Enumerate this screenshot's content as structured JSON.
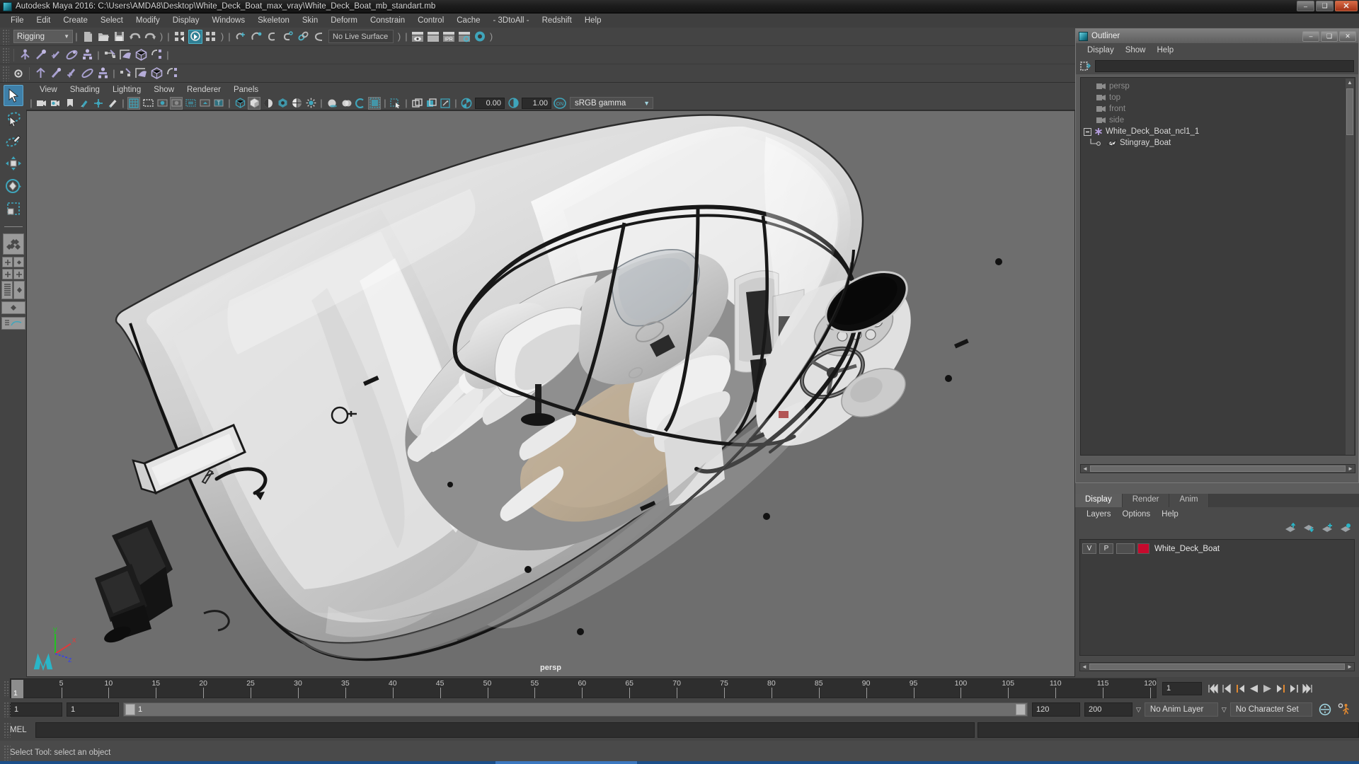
{
  "window": {
    "title": "Autodesk Maya 2016: C:\\Users\\AMDA8\\Desktop\\White_Deck_Boat_max_vray\\White_Deck_Boat_mb_standart.mb",
    "app_icon": "maya-icon",
    "minimize": "–",
    "maximize": "❑",
    "close": "✕"
  },
  "menubar": {
    "items": [
      {
        "label": "File"
      },
      {
        "label": "Edit"
      },
      {
        "label": "Create"
      },
      {
        "label": "Select"
      },
      {
        "label": "Modify"
      },
      {
        "label": "Display"
      },
      {
        "label": "Windows"
      },
      {
        "label": "Skeleton"
      },
      {
        "label": "Skin"
      },
      {
        "label": "Deform"
      },
      {
        "label": "Constrain"
      },
      {
        "label": "Control"
      },
      {
        "label": "Cache"
      },
      {
        "label": "- 3DtoAll -"
      },
      {
        "label": "Redshift"
      },
      {
        "label": "Help"
      }
    ]
  },
  "status_toolbar": {
    "menu_set": "Rigging",
    "menu_set_arrow": "▼",
    "live_surface": "No Live Surface",
    "icons": [
      "new-scene-icon",
      "open-scene-icon",
      "save-scene-icon",
      "undo-icon",
      "redo-icon",
      "select-by-hierarchy-icon",
      "select-by-object-icon",
      "select-by-component-icon",
      "snap-to-grid-icon",
      "snap-to-curve-icon",
      "snap-to-point-icon",
      "snap-to-projected-center-icon",
      "snap-to-view-plane-icon",
      "make-live-icon",
      "render-current-frame-icon",
      "ipr-render-icon",
      "render-settings-icon",
      "hypershade-icon"
    ]
  },
  "shelf": {
    "icons": [
      "joint-tool-icon",
      "ik-handle-tool-icon",
      "ik-spline-handle-icon",
      "paint-weights-icon",
      "skin-bind-icon",
      "cluster-icon",
      "lattice-icon",
      "wrap-icon",
      "sculpt-deformer-icon",
      "parent-constraint-icon",
      "point-constraint-icon",
      "orient-constraint-icon",
      "aim-constraint-icon",
      "pole-vector-icon",
      "mirror-joint-icon",
      "set-driven-key-icon",
      "character-set-icon"
    ]
  },
  "viewport": {
    "menu": [
      {
        "label": "View"
      },
      {
        "label": "Shading"
      },
      {
        "label": "Lighting"
      },
      {
        "label": "Show"
      },
      {
        "label": "Renderer"
      },
      {
        "label": "Panels"
      }
    ],
    "exposure": "0.00",
    "gamma": "1.00",
    "color_management_toggle": "ON",
    "color_profile": "sRGB gamma",
    "color_profile_arrow": "▼",
    "camera_label": "persp",
    "axis_labels": {
      "x": "x",
      "y": "y",
      "z": "z"
    },
    "icons": [
      "select-camera-icon",
      "camera-attributes-icon",
      "bookmark-icon",
      "image-plane-icon",
      "2d-pan-zoom-icon",
      "grease-pencil-icon",
      "grid-toggle-icon",
      "film-gate-icon",
      "resolution-gate-icon",
      "gate-mask-icon",
      "wireframe-icon",
      "smooth-shade-icon",
      "texture-toggle-icon",
      "use-all-lights-icon",
      "shadows-icon",
      "ambient-occlusion-icon",
      "motion-blur-icon",
      "isolate-select-icon",
      "xray-icon",
      "xray-joints-icon",
      "xray-active-icon",
      "exposure-icon",
      "gamma-icon"
    ]
  },
  "toolbox": {
    "items": [
      {
        "name": "select-tool-icon",
        "selected": true
      },
      {
        "name": "lasso-select-tool-icon",
        "selected": false
      },
      {
        "name": "paint-select-tool-icon",
        "selected": false
      },
      {
        "name": "move-tool-icon",
        "selected": false
      },
      {
        "name": "rotate-tool-icon",
        "selected": false
      },
      {
        "name": "scale-tool-icon",
        "selected": false
      },
      {
        "name": "single-perspective-view-icon",
        "selected": false
      },
      {
        "name": "four-view-layout-icon",
        "selected": false
      },
      {
        "name": "outliner-persp-layout-icon",
        "selected": false
      },
      {
        "name": "persp-graph-layout-icon",
        "selected": false
      }
    ]
  },
  "outliner": {
    "title": "Outliner",
    "window_icon": "outliner-icon",
    "minimize": "–",
    "maximize": "❑",
    "close": "✕",
    "menu": [
      {
        "label": "Display"
      },
      {
        "label": "Show"
      },
      {
        "label": "Help"
      }
    ],
    "search_value": "",
    "search_icon": "outliner-filter-icon",
    "tree": [
      {
        "label": "persp",
        "icon": "camera-icon",
        "style": "dim",
        "indent": 0
      },
      {
        "label": "top",
        "icon": "camera-icon",
        "style": "dim",
        "indent": 0
      },
      {
        "label": "front",
        "icon": "camera-icon",
        "style": "dim",
        "indent": 0
      },
      {
        "label": "side",
        "icon": "camera-icon",
        "style": "dim",
        "indent": 0
      },
      {
        "label": "White_Deck_Boat_ncl1_1",
        "icon": "asterisk-icon",
        "style": "light",
        "indent": 0,
        "expander": "-"
      },
      {
        "label": "Stingray_Boat",
        "icon": "mesh-icon",
        "style": "light",
        "indent": 1
      }
    ],
    "scroll_up": "▲",
    "scroll_left": "◄",
    "scroll_right": "►"
  },
  "layer_editor": {
    "tabs": [
      {
        "label": "Display",
        "active": true
      },
      {
        "label": "Render",
        "active": false
      },
      {
        "label": "Anim",
        "active": false
      }
    ],
    "menu": [
      {
        "label": "Layers"
      },
      {
        "label": "Options"
      },
      {
        "label": "Help"
      }
    ],
    "toolbar_icons": [
      "move-layer-up-icon",
      "move-layer-down-icon",
      "new-layer-icon",
      "new-layer-from-selected-icon"
    ],
    "layers": [
      {
        "visibility": "V",
        "playback": "P",
        "state": "",
        "color": "#c60a2d",
        "name": "White_Deck_Boat"
      }
    ],
    "scroll_left": "◄",
    "scroll_right": "►"
  },
  "timeline": {
    "ticks": [
      5,
      10,
      15,
      20,
      25,
      30,
      35,
      40,
      45,
      50,
      55,
      60,
      65,
      70,
      75,
      80,
      85,
      90,
      95,
      100,
      105,
      110,
      115,
      120
    ],
    "start": 1,
    "end": 120,
    "current_frame_marker": "1",
    "current_frame_field": "1",
    "playback_buttons": [
      "go-to-start-icon",
      "step-back-keyframe-icon",
      "step-back-frame-icon",
      "play-backwards-icon",
      "play-forwards-icon",
      "step-forward-frame-icon",
      "step-forward-keyframe-icon",
      "go-to-end-icon"
    ]
  },
  "range_slider": {
    "anim_start": "1",
    "range_start": "1",
    "playhead_label": "1",
    "range_end": "120",
    "anim_end": "200",
    "anim_layer": "No Anim Layer",
    "anim_layer_arrow": "▽",
    "character_set": "No Character Set",
    "character_set_arrow": "▽",
    "auto_key_icon": "auto-keyframe-icon",
    "anim_prefs_icon": "animation-preferences-icon"
  },
  "command_line": {
    "language": "MEL",
    "input_value": "",
    "output_value": ""
  },
  "help_line": {
    "message": "Select Tool: select an object"
  },
  "colors": {
    "accent_teal": "#4fb5c9",
    "panel_bg": "#444444",
    "viewport_bg": "#6e6e6e",
    "layer_color": "#c60a2d",
    "title_text": "#d8d8d8"
  }
}
